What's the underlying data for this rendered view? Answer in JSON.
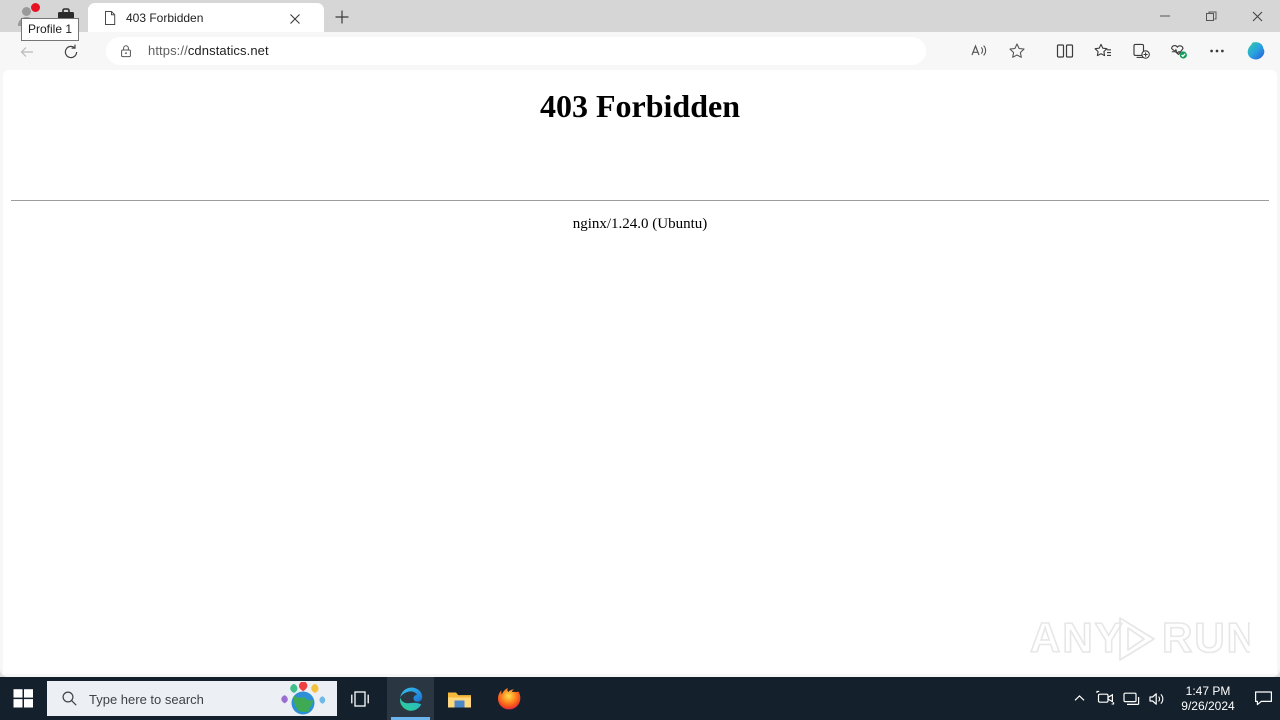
{
  "window": {
    "profile_tooltip": "Profile 1",
    "controls": {
      "minimize": "Minimize",
      "restore": "Restore",
      "close": "Close"
    }
  },
  "tabs": [
    {
      "title": "403 Forbidden",
      "favicon": "page-icon",
      "close_label": "Close tab"
    }
  ],
  "newtab_label": "New tab",
  "toolbar": {
    "back_label": "Back",
    "refresh_label": "Refresh",
    "url_scheme": "https://",
    "url_host": "cdnstatics.net",
    "url_full": "https://cdnstatics.net",
    "lock_icon": "lock-icon",
    "right_icons": [
      {
        "name": "read-aloud-icon",
        "label": "Read aloud"
      },
      {
        "name": "favorite-star-icon",
        "label": "Add this page to favorites"
      },
      {
        "name": "split-screen-icon",
        "label": "Split screen"
      },
      {
        "name": "favorites-list-icon",
        "label": "Favorites"
      },
      {
        "name": "collections-icon",
        "label": "Collections"
      },
      {
        "name": "browser-essentials-icon",
        "label": "Browser essentials"
      },
      {
        "name": "settings-more-icon",
        "label": "Settings and more"
      },
      {
        "name": "copilot-icon",
        "label": "Copilot"
      }
    ]
  },
  "page": {
    "heading": "403 Forbidden",
    "server": "nginx/1.24.0 (Ubuntu)"
  },
  "watermark": {
    "text_left": "ANY",
    "text_right": "RUN"
  },
  "taskbar": {
    "start_label": "Start",
    "search_placeholder": "Type here to search",
    "taskview_label": "Task View",
    "apps": [
      {
        "name": "edge",
        "label": "Microsoft Edge",
        "active": true
      },
      {
        "name": "file-explorer",
        "label": "File Explorer",
        "active": false
      },
      {
        "name": "firefox",
        "label": "Mozilla Firefox",
        "active": false
      }
    ],
    "tray": [
      {
        "name": "show-hidden-icons-icon",
        "label": "Show hidden icons"
      },
      {
        "name": "screen-capture-icon",
        "label": "Screen recording"
      },
      {
        "name": "network-icon",
        "label": "Network"
      },
      {
        "name": "volume-icon",
        "label": "Volume"
      }
    ],
    "time": "1:47 PM",
    "date": "9/26/2024",
    "action_center_label": "Notifications"
  },
  "colors": {
    "tabstrip": "#d6d6d6",
    "toolbar": "#f7f7f7",
    "taskbar": "#14202b",
    "accent_red": "#e81123",
    "edge_underline": "#6cb4ee"
  }
}
